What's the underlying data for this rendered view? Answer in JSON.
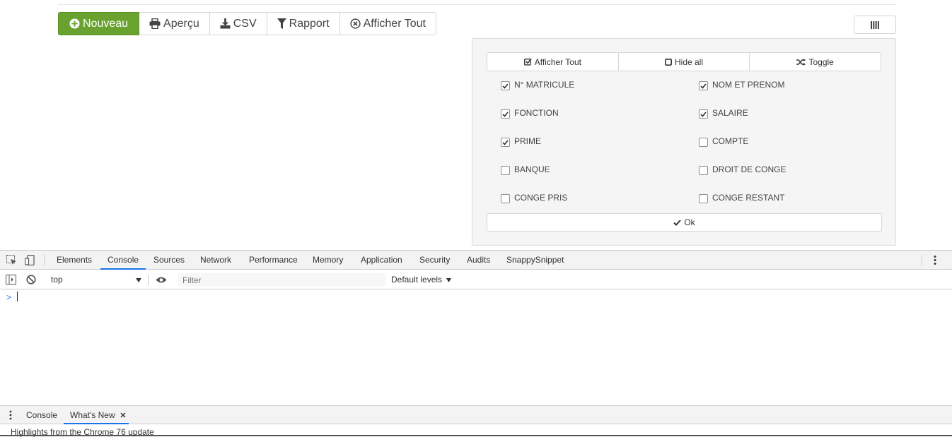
{
  "toolbar": {
    "nouveau": "Nouveau",
    "apercu": "Aperçu",
    "csv": "CSV",
    "rapport": "Rapport",
    "afficher_tout": "Afficher Tout"
  },
  "panel": {
    "show_all": "Afficher Tout",
    "hide_all": "Hide all",
    "toggle": "Toggle",
    "ok": "Ok",
    "columns": [
      {
        "label": "N° MATRICULE",
        "checked": true
      },
      {
        "label": "NOM ET PRENOM",
        "checked": true
      },
      {
        "label": "FONCTION",
        "checked": true
      },
      {
        "label": "SALAIRE",
        "checked": true
      },
      {
        "label": "PRIME",
        "checked": true
      },
      {
        "label": "COMPTE",
        "checked": false
      },
      {
        "label": "BANQUE",
        "checked": false
      },
      {
        "label": "DROIT DE CONGE",
        "checked": false
      },
      {
        "label": "CONGE PRIS",
        "checked": false
      },
      {
        "label": "CONGE RESTANT",
        "checked": false
      }
    ]
  },
  "devtools": {
    "tabs": [
      "Elements",
      "Console",
      "Sources",
      "Network",
      "Performance",
      "Memory",
      "Application",
      "Security",
      "Audits",
      "SnappySnippet"
    ],
    "active_tab": "Console",
    "context": "top",
    "filter_placeholder": "Filter",
    "levels": "Default levels",
    "prompt": ">",
    "drawer_tabs": [
      "Console",
      "What's New"
    ],
    "whats_new_text": "Highlights from the Chrome 76 update"
  },
  "colors": {
    "primary": "#6aa22f",
    "accent": "#1a73e8"
  }
}
